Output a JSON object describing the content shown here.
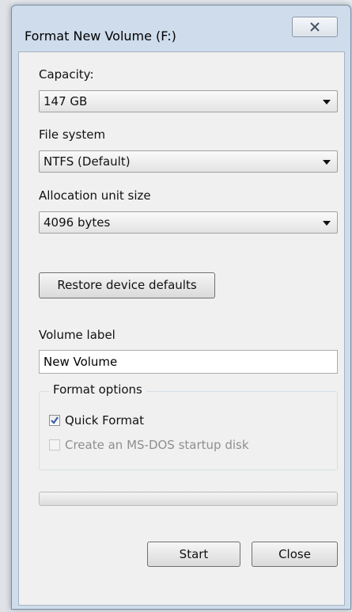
{
  "window": {
    "title": "Format New Volume (F:)"
  },
  "capacity": {
    "label": "Capacity:",
    "value": "147 GB"
  },
  "file_system": {
    "label": "File system",
    "value": "NTFS (Default)"
  },
  "allocation": {
    "label": "Allocation unit size",
    "value": "4096 bytes"
  },
  "restore_button": "Restore device defaults",
  "volume_label": {
    "label": "Volume label",
    "value": "New Volume"
  },
  "format_options": {
    "legend": "Format options",
    "quick_format": {
      "label": "Quick Format",
      "checked": true
    },
    "msdos": {
      "label": "Create an MS-DOS startup disk",
      "checked": false,
      "disabled": true
    }
  },
  "progress": {
    "value": 0
  },
  "buttons": {
    "start": "Start",
    "close": "Close"
  },
  "icons": {
    "close": "close-x-icon",
    "dropdown": "chevron-down-icon",
    "check": "checkmark-icon"
  },
  "colors": {
    "window_frame": "#cfdcec",
    "client_bg": "#f0f0f0",
    "checkmark": "#3a5ea8"
  }
}
